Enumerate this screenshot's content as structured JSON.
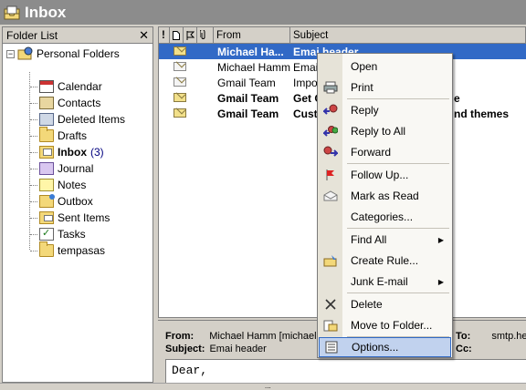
{
  "window": {
    "title": "Inbox"
  },
  "folder_pane": {
    "header": "Folder List",
    "close_glyph": "✕",
    "root": {
      "label": "Personal Folders",
      "expander": "−"
    },
    "folders": [
      {
        "label": "Calendar",
        "icon": "calendar-icon"
      },
      {
        "label": "Contacts",
        "icon": "contacts-icon"
      },
      {
        "label": "Deleted Items",
        "icon": "deleted-items-icon"
      },
      {
        "label": "Drafts",
        "icon": "drafts-icon"
      },
      {
        "label": "Inbox",
        "count": "(3)",
        "icon": "inbox-icon",
        "bold": true
      },
      {
        "label": "Journal",
        "icon": "journal-icon"
      },
      {
        "label": "Notes",
        "icon": "notes-icon"
      },
      {
        "label": "Outbox",
        "icon": "outbox-icon"
      },
      {
        "label": "Sent Items",
        "icon": "sent-items-icon"
      },
      {
        "label": "Tasks",
        "icon": "tasks-icon"
      },
      {
        "label": "tempasas",
        "icon": "folder-icon"
      }
    ]
  },
  "message_list": {
    "columns": {
      "importance": "!",
      "icon": "",
      "flag": "",
      "attachment": "",
      "from": "From",
      "subject": "Subject"
    },
    "messages": [
      {
        "from": "Michael Ha...",
        "subject": "Emai header",
        "read": false,
        "selected": true
      },
      {
        "from": "Michael Hamm",
        "subject": "Email",
        "read": true,
        "selected": false
      },
      {
        "from": "Gmail Team",
        "subject": "Impor",
        "read": true,
        "selected": false
      },
      {
        "from": "Gmail Team",
        "subject": "Get G",
        "subject_tail": "e",
        "read": false,
        "selected": false
      },
      {
        "from": "Gmail Team",
        "subject": "Cust",
        "subject_tail": "nd themes",
        "read": false,
        "selected": false
      }
    ]
  },
  "preview": {
    "from_label": "From:",
    "from_value": "Michael Hamm [michael.h",
    "subject_label": "Subject:",
    "subject_value": "Emai header",
    "to_label": "To:",
    "to_value": "smtp.he",
    "cc_label": "Cc:",
    "body": "Dear,"
  },
  "context_menu": {
    "items": [
      {
        "label": "Open",
        "icon": "open-icon"
      },
      {
        "label": "Print",
        "icon": "print-icon"
      },
      {
        "label": "Reply",
        "icon": "reply-icon"
      },
      {
        "label": "Reply to All",
        "icon": "reply-all-icon"
      },
      {
        "label": "Forward",
        "icon": "forward-icon"
      },
      {
        "label": "Follow Up...",
        "icon": "flag-icon"
      },
      {
        "label": "Mark as Read",
        "icon": "mark-read-icon"
      },
      {
        "label": "Categories...",
        "icon": ""
      },
      {
        "label": "Find All",
        "icon": "",
        "submenu": "▶"
      },
      {
        "label": "Create Rule...",
        "icon": "create-rule-icon"
      },
      {
        "label": "Junk E-mail",
        "icon": "",
        "submenu": "▶"
      },
      {
        "label": "Delete",
        "icon": "delete-icon"
      },
      {
        "label": "Move to Folder...",
        "icon": "move-folder-icon"
      },
      {
        "label": "Options...",
        "icon": "options-icon",
        "highlighted": true
      }
    ]
  },
  "splitter": {
    "grip": "..."
  },
  "colors": {
    "selection": "#3169c6",
    "menu_highlight": "#c1d2ee",
    "title_bar": "#8c8c8c",
    "unread_count": "#00007f"
  }
}
